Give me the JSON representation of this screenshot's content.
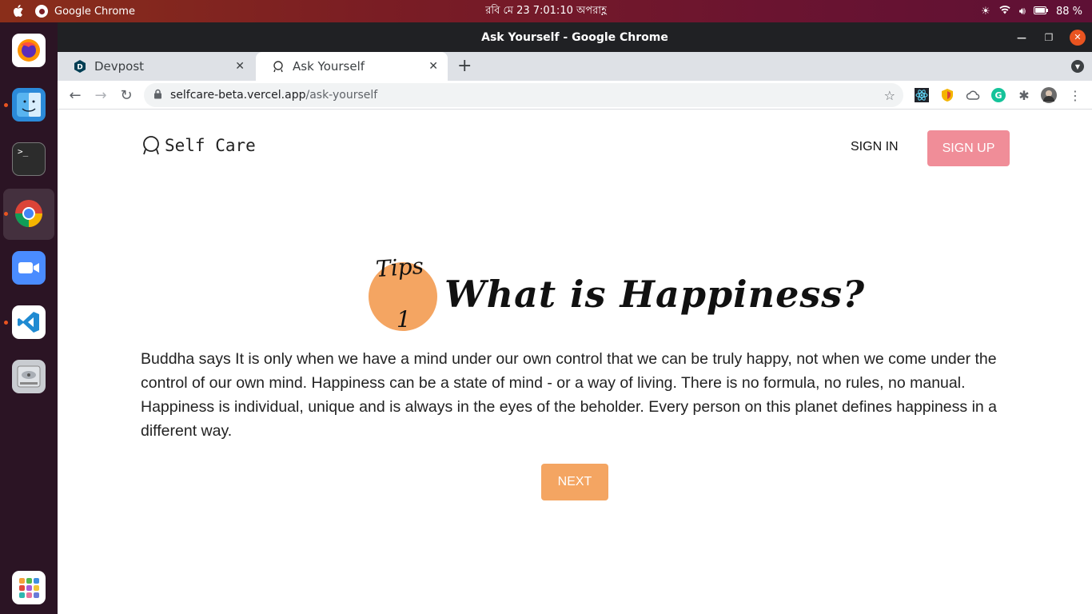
{
  "topbar": {
    "app_name": "Google Chrome",
    "clock": "রবি মে 23   7:01:10 অপরাহ্ণ",
    "battery": "88 %"
  },
  "dock": {
    "items": [
      "firefox",
      "finder",
      "terminal",
      "chrome",
      "zoom",
      "vscode",
      "disk",
      "app-grid"
    ]
  },
  "window": {
    "title": "Ask Yourself - Google Chrome"
  },
  "tabs": [
    {
      "label": "Devpost"
    },
    {
      "label": "Ask Yourself"
    }
  ],
  "address": {
    "host": "selfcare-beta.vercel.app",
    "path": "/ask-yourself"
  },
  "site": {
    "logo": "Self Care",
    "signin": "SIGN IN",
    "signup": "SIGN UP",
    "tips_label": "Tips",
    "tips_number": "1",
    "heading": "What is Happiness?",
    "body": "Buddha says It is only when we have a mind under our own control that we can be truly happy, not when we come under the control of our own mind. Happiness can be a state of mind - or a way of living. There is no formula, no rules, no manual. Happiness is individual, unique and is always in the eyes of the beholder. Every person on this planet defines happiness in a different way.",
    "next": "NEXT"
  },
  "colors": {
    "accent_orange": "#f4a562",
    "accent_pink": "#f08d98",
    "ubuntu_orange": "#e95420"
  }
}
